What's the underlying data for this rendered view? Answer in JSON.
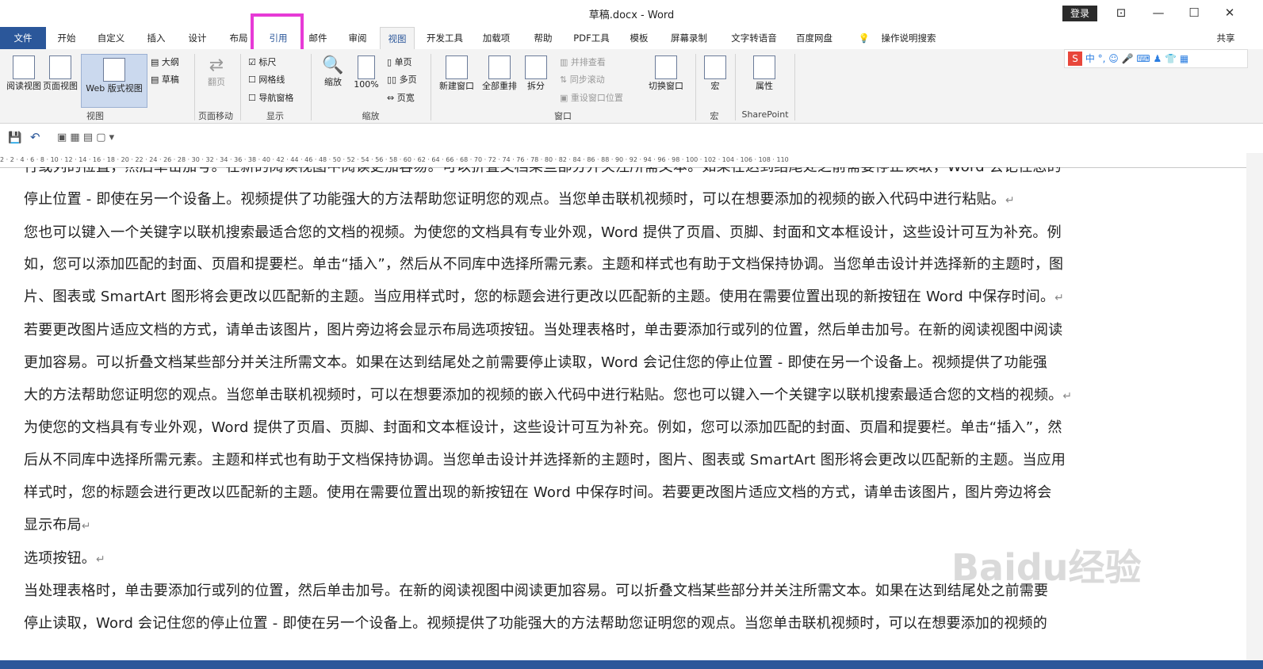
{
  "window": {
    "title": "草稿.docx - Word",
    "login": "登录"
  },
  "tabs": [
    "文件",
    "开始",
    "自定义",
    "插入",
    "设计",
    "布局",
    "引用",
    "邮件",
    "审阅",
    "视图",
    "开发工具",
    "加载项",
    "帮助",
    "PDF工具",
    "模板",
    "屏幕录制",
    "文字转语音",
    "百度网盘"
  ],
  "tell_me": "操作说明搜索",
  "share": "共享",
  "ribbon": {
    "views": {
      "read": "阅读视图",
      "print": "页面视图",
      "web": "Web 版式视图",
      "outline": "大纲",
      "draft": "草稿",
      "label": "视图"
    },
    "page_move": {
      "flip": "翻页",
      "label": "页面移动"
    },
    "show": {
      "ruler": "标尺",
      "grid": "网格线",
      "nav": "导航窗格",
      "label": "显示"
    },
    "zoom": {
      "zoom": "缩放",
      "pct": "100%",
      "one": "单页",
      "multi": "多页",
      "width": "页宽",
      "label": "缩放"
    },
    "window": {
      "new": "新建窗口",
      "arrange": "全部重排",
      "split": "拆分",
      "side": "并排查看",
      "sync": "同步滚动",
      "reset": "重设窗口位置",
      "switch": "切换窗口",
      "label": "窗口"
    },
    "macro": {
      "macro": "宏",
      "label": "宏"
    },
    "sharepoint": {
      "props": "属性",
      "label": "SharePoint"
    }
  },
  "ime": {
    "mode": "中"
  },
  "ruler_ticks": "2 · 2 · 4 · 6 · 8 · 10 · 12 · 14 · 16 · 18 · 20 · 22 · 24 · 26 · 28 · 30 · 32 · 34 · 36 · 38 · 40 · 42 · 44 · 46 · 48 · 50 · 52 · 54 · 56 · 58 · 60 · 62 · 64 · 66 · 68 · 70 · 72 · 74 · 76 · 78 · 80 · 82 · 84 · 86 · 88 · 90 · 92 · 94 · 96 · 98 · 100 · 102 · 104 · 106 · 108 · 110",
  "doc": {
    "line0": "行或列的位置，然后单击加号。在新的阅读视图中阅读更加容易。可以折叠文档某些部分并关注所需文本。如果在达到结尾处之前需要停止读取，Word 会记住您的",
    "line1": "停止位置 - 即使在另一个设备上。视频提供了功能强大的方法帮助您证明您的观点。当您单击联机视频时，可以在想要添加的视频的嵌入代码中进行粘贴。",
    "line2": "您也可以键入一个关键字以联机搜索最适合您的文档的视频。为使您的文档具有专业外观，Word 提供了页眉、页脚、封面和文本框设计，这些设计可互为补充。例",
    "line3": "如，您可以添加匹配的封面、页眉和提要栏。单击“插入”，然后从不同库中选择所需元素。主题和样式也有助于文档保持协调。当您单击设计并选择新的主题时，图",
    "line4": "片、图表或 SmartArt 图形将会更改以匹配新的主题。当应用样式时，您的标题会进行更改以匹配新的主题。使用在需要位置出现的新按钮在 Word 中保存时间。",
    "line5": "若要更改图片适应文档的方式，请单击该图片，图片旁边将会显示布局选项按钮。当处理表格时，单击要添加行或列的位置，然后单击加号。在新的阅读视图中阅读",
    "line6": "更加容易。可以折叠文档某些部分并关注所需文本。如果在达到结尾处之前需要停止读取，Word 会记住您的停止位置 - 即使在另一个设备上。视频提供了功能强",
    "line7": "大的方法帮助您证明您的观点。当您单击联机视频时，可以在想要添加的视频的嵌入代码中进行粘贴。您也可以键入一个关键字以联机搜索最适合您的文档的视频。",
    "line8": "为使您的文档具有专业外观，Word 提供了页眉、页脚、封面和文本框设计，这些设计可互为补充。例如，您可以添加匹配的封面、页眉和提要栏。单击“插入”，然",
    "line9": "后从不同库中选择所需元素。主题和样式也有助于文档保持协调。当您单击设计并选择新的主题时，图片、图表或 SmartArt 图形将会更改以匹配新的主题。当应用",
    "line10": "样式时，您的标题会进行更改以匹配新的主题。使用在需要位置出现的新按钮在 Word 中保存时间。若要更改图片适应文档的方式，请单击该图片，图片旁边将会",
    "line11": "显示布局",
    "line12": "选项按钮。",
    "line13": "当处理表格时，单击要添加行或列的位置，然后单击加号。在新的阅读视图中阅读更加容易。可以折叠文档某些部分并关注所需文本。如果在达到结尾处之前需要",
    "line14": "停止读取，Word 会记住您的停止位置 - 即使在另一个设备上。视频提供了功能强大的方法帮助您证明您的观点。当您单击联机视频时，可以在想要添加的视频的"
  },
  "watermark": "Baidu经验"
}
